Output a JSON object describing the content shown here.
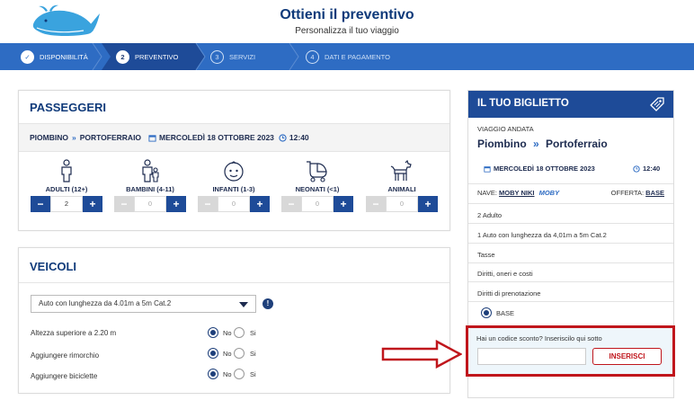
{
  "header": {
    "title": "Ottieni il preventivo",
    "subtitle": "Personalizza il tuo viaggio"
  },
  "steps": [
    {
      "num": "✓",
      "label": "DISPONIBILITÀ",
      "state": "done"
    },
    {
      "num": "2",
      "label": "PREVENTIVO",
      "state": "active"
    },
    {
      "num": "3",
      "label": "SERVIZI",
      "state": "todo"
    },
    {
      "num": "4",
      "label": "DATI E PAGAMENTO",
      "state": "todo"
    }
  ],
  "passengers": {
    "title": "PASSEGGERI",
    "route": {
      "from": "PIOMBINO",
      "to": "PORTOFERRAIO",
      "date": "MERCOLEDÌ 18 OTTOBRE 2023",
      "time": "12:40"
    },
    "types": [
      {
        "label": "ADULTI (12+)",
        "value": "2",
        "icon": "adult-icon",
        "enabled": true
      },
      {
        "label": "BAMBINI (4-11)",
        "value": "0",
        "icon": "child-icon",
        "enabled": false
      },
      {
        "label": "INFANTI (1-3)",
        "value": "0",
        "icon": "infant-icon",
        "enabled": false
      },
      {
        "label": "NEONATI (<1)",
        "value": "0",
        "icon": "stroller-icon",
        "enabled": false
      },
      {
        "label": "ANIMALI",
        "value": "0",
        "icon": "dog-icon",
        "enabled": false
      }
    ]
  },
  "vehicles": {
    "title": "VEICOLI",
    "selected_vehicle": "Auto con lunghezza da 4.01m a 5m Cat.2",
    "options": [
      {
        "label": "Altezza superiore a 2.20 m",
        "no": "No",
        "yes": "Si",
        "selected": "No"
      },
      {
        "label": "Aggiungere rimorchio",
        "no": "No",
        "yes": "Si",
        "selected": "No"
      },
      {
        "label": "Aggiungere biciclette",
        "no": "No",
        "yes": "Si",
        "selected": "No"
      }
    ]
  },
  "ticket": {
    "title": "IL TUO BIGLIETTO",
    "trip_type": "VIAGGIO ANDATA",
    "from": "Piombino",
    "to": "Portoferraio",
    "date": "MERCOLEDÌ 18 OTTOBRE 2023",
    "time": "12:40",
    "ship_label": "NAVE:",
    "ship_name": "MOBY NIKI",
    "ship_brand": "MOBY",
    "offer_label": "OFFERTA:",
    "offer_name": "BASE",
    "items": [
      "2 Adulto",
      "1 Auto con lunghezza da 4,01m a 5m Cat.2",
      "Tasse",
      "Diritti, oneri e costi",
      "Diritti di prenotazione"
    ],
    "fare_option": "BASE"
  },
  "promo": {
    "prompt": "Hai un codice sconto? Inseriscilo qui sotto",
    "input_value": "",
    "button_label": "INSERISCI"
  },
  "colors": {
    "primary": "#1e4b98",
    "stepbar": "#2e6cc3",
    "highlight": "#c0161c"
  }
}
